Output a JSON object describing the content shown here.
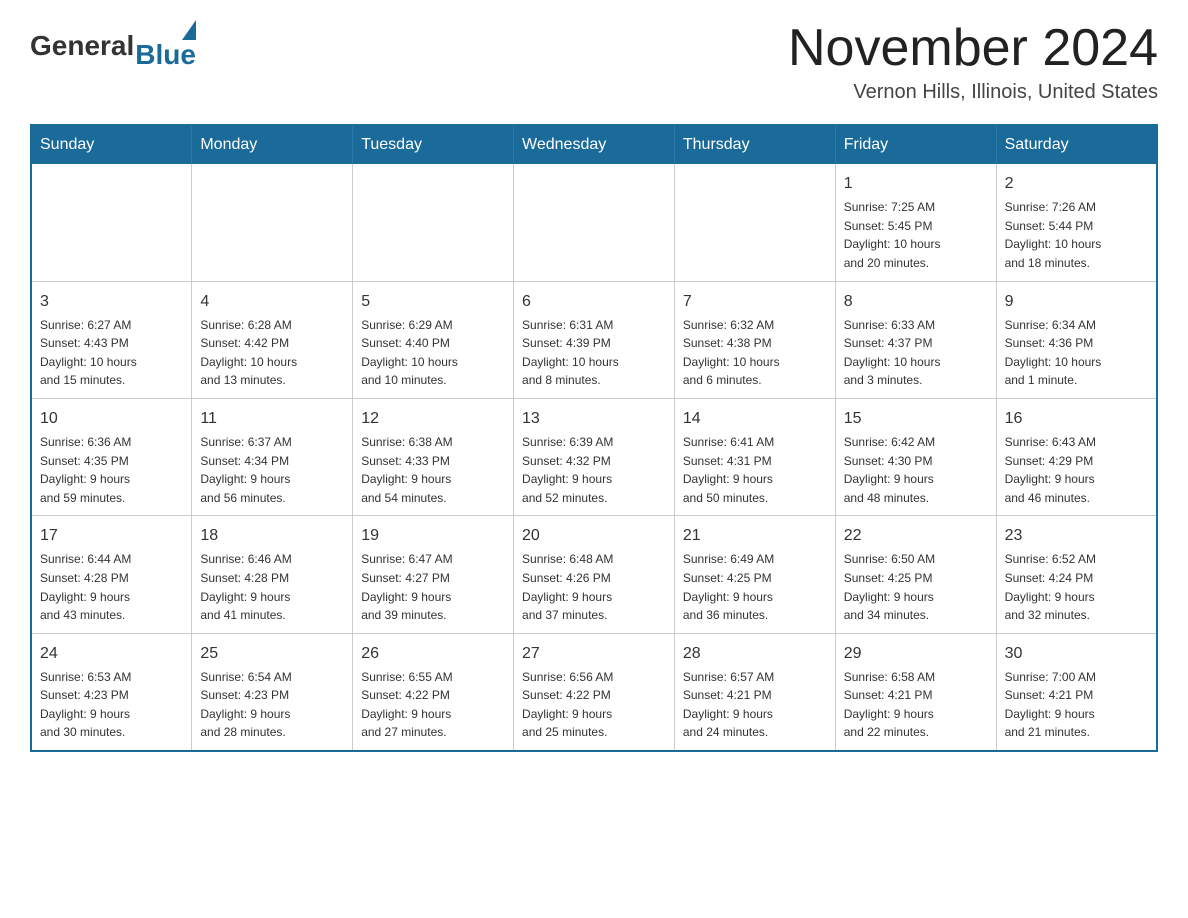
{
  "header": {
    "logo_general": "General",
    "logo_blue": "Blue",
    "month_title": "November 2024",
    "location": "Vernon Hills, Illinois, United States"
  },
  "weekdays": [
    "Sunday",
    "Monday",
    "Tuesday",
    "Wednesday",
    "Thursday",
    "Friday",
    "Saturday"
  ],
  "weeks": [
    [
      {
        "day": "",
        "info": ""
      },
      {
        "day": "",
        "info": ""
      },
      {
        "day": "",
        "info": ""
      },
      {
        "day": "",
        "info": ""
      },
      {
        "day": "",
        "info": ""
      },
      {
        "day": "1",
        "info": "Sunrise: 7:25 AM\nSunset: 5:45 PM\nDaylight: 10 hours\nand 20 minutes."
      },
      {
        "day": "2",
        "info": "Sunrise: 7:26 AM\nSunset: 5:44 PM\nDaylight: 10 hours\nand 18 minutes."
      }
    ],
    [
      {
        "day": "3",
        "info": "Sunrise: 6:27 AM\nSunset: 4:43 PM\nDaylight: 10 hours\nand 15 minutes."
      },
      {
        "day": "4",
        "info": "Sunrise: 6:28 AM\nSunset: 4:42 PM\nDaylight: 10 hours\nand 13 minutes."
      },
      {
        "day": "5",
        "info": "Sunrise: 6:29 AM\nSunset: 4:40 PM\nDaylight: 10 hours\nand 10 minutes."
      },
      {
        "day": "6",
        "info": "Sunrise: 6:31 AM\nSunset: 4:39 PM\nDaylight: 10 hours\nand 8 minutes."
      },
      {
        "day": "7",
        "info": "Sunrise: 6:32 AM\nSunset: 4:38 PM\nDaylight: 10 hours\nand 6 minutes."
      },
      {
        "day": "8",
        "info": "Sunrise: 6:33 AM\nSunset: 4:37 PM\nDaylight: 10 hours\nand 3 minutes."
      },
      {
        "day": "9",
        "info": "Sunrise: 6:34 AM\nSunset: 4:36 PM\nDaylight: 10 hours\nand 1 minute."
      }
    ],
    [
      {
        "day": "10",
        "info": "Sunrise: 6:36 AM\nSunset: 4:35 PM\nDaylight: 9 hours\nand 59 minutes."
      },
      {
        "day": "11",
        "info": "Sunrise: 6:37 AM\nSunset: 4:34 PM\nDaylight: 9 hours\nand 56 minutes."
      },
      {
        "day": "12",
        "info": "Sunrise: 6:38 AM\nSunset: 4:33 PM\nDaylight: 9 hours\nand 54 minutes."
      },
      {
        "day": "13",
        "info": "Sunrise: 6:39 AM\nSunset: 4:32 PM\nDaylight: 9 hours\nand 52 minutes."
      },
      {
        "day": "14",
        "info": "Sunrise: 6:41 AM\nSunset: 4:31 PM\nDaylight: 9 hours\nand 50 minutes."
      },
      {
        "day": "15",
        "info": "Sunrise: 6:42 AM\nSunset: 4:30 PM\nDaylight: 9 hours\nand 48 minutes."
      },
      {
        "day": "16",
        "info": "Sunrise: 6:43 AM\nSunset: 4:29 PM\nDaylight: 9 hours\nand 46 minutes."
      }
    ],
    [
      {
        "day": "17",
        "info": "Sunrise: 6:44 AM\nSunset: 4:28 PM\nDaylight: 9 hours\nand 43 minutes."
      },
      {
        "day": "18",
        "info": "Sunrise: 6:46 AM\nSunset: 4:28 PM\nDaylight: 9 hours\nand 41 minutes."
      },
      {
        "day": "19",
        "info": "Sunrise: 6:47 AM\nSunset: 4:27 PM\nDaylight: 9 hours\nand 39 minutes."
      },
      {
        "day": "20",
        "info": "Sunrise: 6:48 AM\nSunset: 4:26 PM\nDaylight: 9 hours\nand 37 minutes."
      },
      {
        "day": "21",
        "info": "Sunrise: 6:49 AM\nSunset: 4:25 PM\nDaylight: 9 hours\nand 36 minutes."
      },
      {
        "day": "22",
        "info": "Sunrise: 6:50 AM\nSunset: 4:25 PM\nDaylight: 9 hours\nand 34 minutes."
      },
      {
        "day": "23",
        "info": "Sunrise: 6:52 AM\nSunset: 4:24 PM\nDaylight: 9 hours\nand 32 minutes."
      }
    ],
    [
      {
        "day": "24",
        "info": "Sunrise: 6:53 AM\nSunset: 4:23 PM\nDaylight: 9 hours\nand 30 minutes."
      },
      {
        "day": "25",
        "info": "Sunrise: 6:54 AM\nSunset: 4:23 PM\nDaylight: 9 hours\nand 28 minutes."
      },
      {
        "day": "26",
        "info": "Sunrise: 6:55 AM\nSunset: 4:22 PM\nDaylight: 9 hours\nand 27 minutes."
      },
      {
        "day": "27",
        "info": "Sunrise: 6:56 AM\nSunset: 4:22 PM\nDaylight: 9 hours\nand 25 minutes."
      },
      {
        "day": "28",
        "info": "Sunrise: 6:57 AM\nSunset: 4:21 PM\nDaylight: 9 hours\nand 24 minutes."
      },
      {
        "day": "29",
        "info": "Sunrise: 6:58 AM\nSunset: 4:21 PM\nDaylight: 9 hours\nand 22 minutes."
      },
      {
        "day": "30",
        "info": "Sunrise: 7:00 AM\nSunset: 4:21 PM\nDaylight: 9 hours\nand 21 minutes."
      }
    ]
  ]
}
